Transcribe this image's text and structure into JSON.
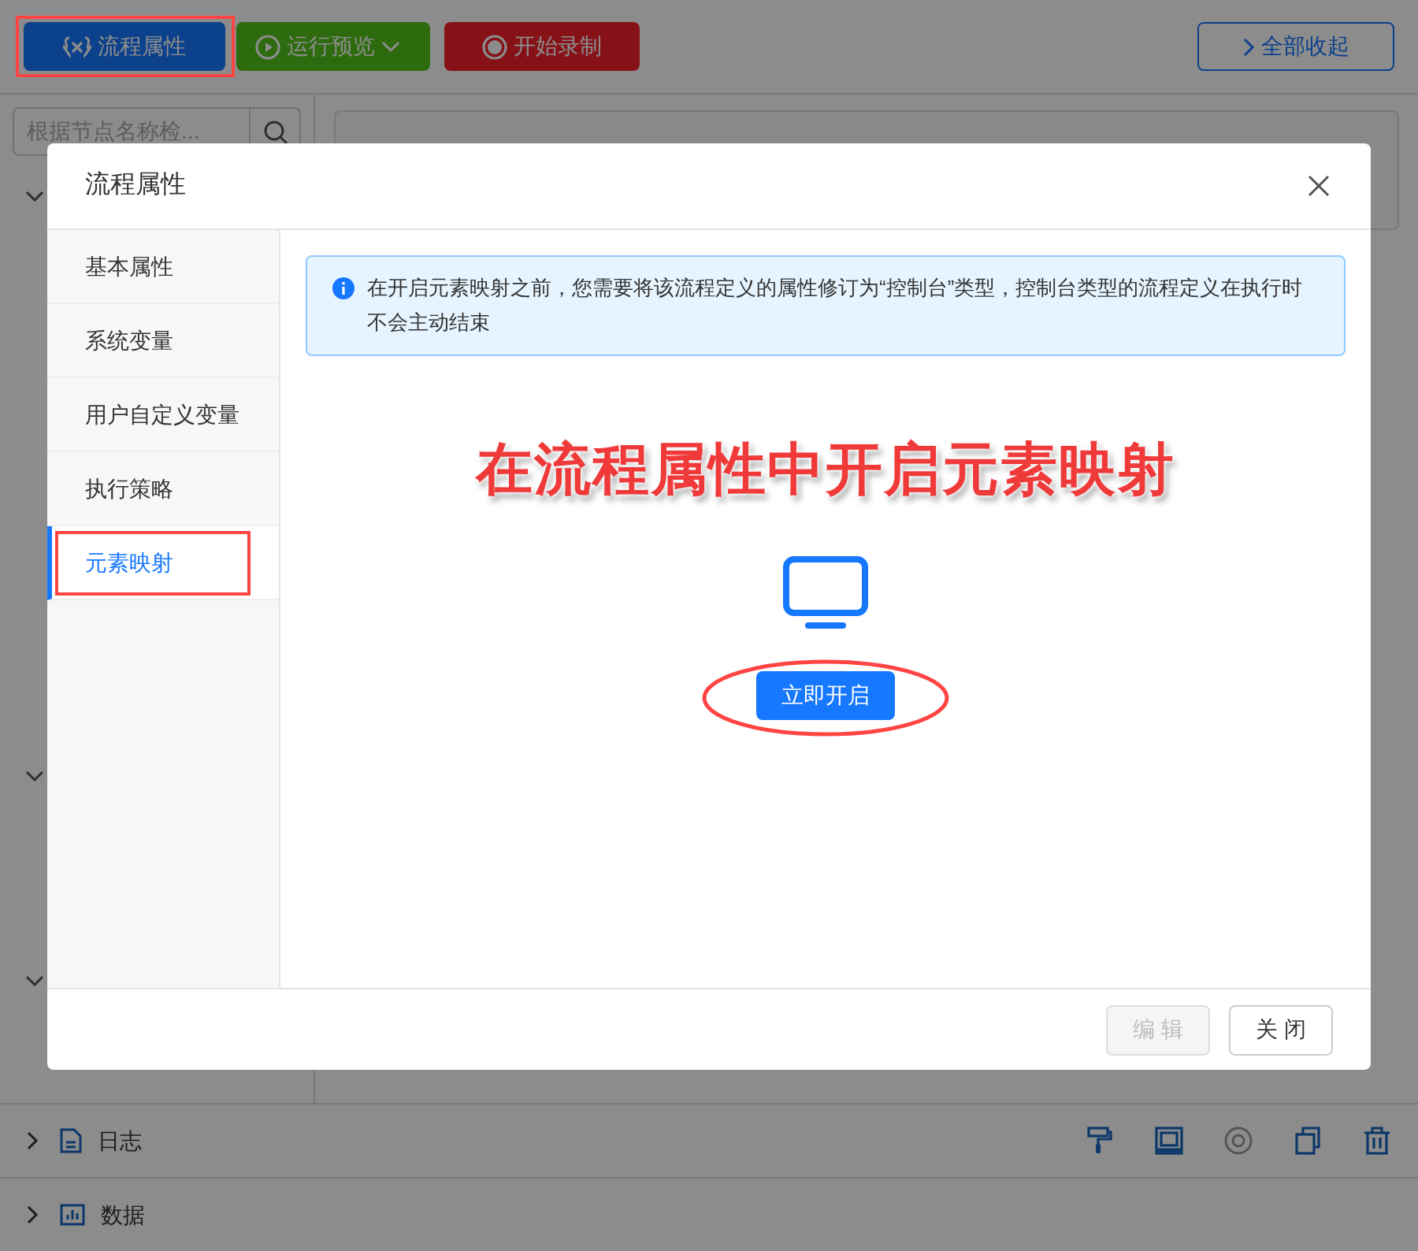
{
  "toolbar": {
    "buttons": [
      {
        "label": "流程属性",
        "kind": "primary",
        "highlighted": true
      },
      {
        "label": "运行预览",
        "kind": "success",
        "highlighted": false
      },
      {
        "label": "开始录制",
        "kind": "danger",
        "highlighted": false
      }
    ],
    "collapse_all": {
      "label": "全部收起"
    }
  },
  "search": {
    "placeholder": "根据节点名称检..."
  },
  "bottom_panels": [
    {
      "label": "日志",
      "expanded": false,
      "tools": [
        {
          "kind": "roller",
          "disabled": false
        },
        {
          "kind": "save",
          "disabled": false
        },
        {
          "kind": "stop",
          "disabled": true
        },
        {
          "kind": "copy",
          "disabled": false
        },
        {
          "kind": "trash",
          "disabled": false
        }
      ]
    },
    {
      "label": "数据",
      "expanded": false
    }
  ],
  "dialog": {
    "title": "流程属性",
    "nav": [
      {
        "label": "基本属性",
        "selected": false,
        "highlighted": false
      },
      {
        "label": "系统变量",
        "selected": false,
        "highlighted": false
      },
      {
        "label": "用户自定义变量",
        "selected": false,
        "highlighted": false
      },
      {
        "label": "执行策略",
        "selected": false,
        "highlighted": false
      },
      {
        "label": "元素映射",
        "selected": true,
        "highlighted": true
      }
    ],
    "info": "在开启元素映射之前，您需要将该流程定义的属性修订为“控制台”类型，控制台类型的流程定义在执行时不会主动结束",
    "annotation": "在流程属性中开启元素映射",
    "enable_button": {
      "label": "立即开启",
      "circled": true
    },
    "footer_buttons": [
      {
        "label": "编 辑",
        "disabled": true
      },
      {
        "label": "关 闭",
        "disabled": false
      }
    ]
  }
}
